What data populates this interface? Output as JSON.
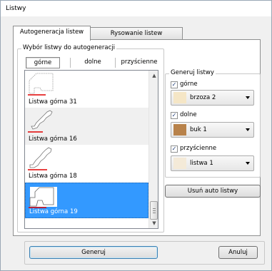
{
  "window": {
    "title": "Listwy"
  },
  "tabs": [
    {
      "label": "Autogeneracja listew"
    },
    {
      "label": "Rysowanie listew"
    }
  ],
  "selection_group": {
    "label": "Wybór listwy do autogeneracji",
    "subtabs": [
      {
        "label": "górne",
        "active": true
      },
      {
        "label": "dolne",
        "active": false
      },
      {
        "label": "przyścienne",
        "active": false
      }
    ]
  },
  "list": {
    "items": [
      {
        "label": "Listwa górna 31",
        "selected": false
      },
      {
        "label": "Listwa górna 16",
        "selected": false
      },
      {
        "label": "Listwa górna 18",
        "selected": false
      },
      {
        "label": "Listwa górna 19",
        "selected": true
      }
    ],
    "selection_color": "#3399ff"
  },
  "generate_group": {
    "label": "Generuj listwy",
    "options": [
      {
        "label": "górne",
        "checked": true,
        "material": "brzoza 2",
        "swatch_color": "#f5e6c6"
      },
      {
        "label": "dolne",
        "checked": true,
        "material": "buk 1",
        "swatch_color": "#b8824a"
      },
      {
        "label": "przyścienne",
        "checked": true,
        "material": "listwa 1",
        "swatch_color": "#f4ead8"
      }
    ]
  },
  "buttons": {
    "remove_auto": "Usuń auto listwy",
    "generate": "Generuj",
    "cancel": "Anuluj"
  },
  "icons": {
    "checkmark": "✓",
    "scroll_up": "▲",
    "scroll_down": "▼"
  }
}
